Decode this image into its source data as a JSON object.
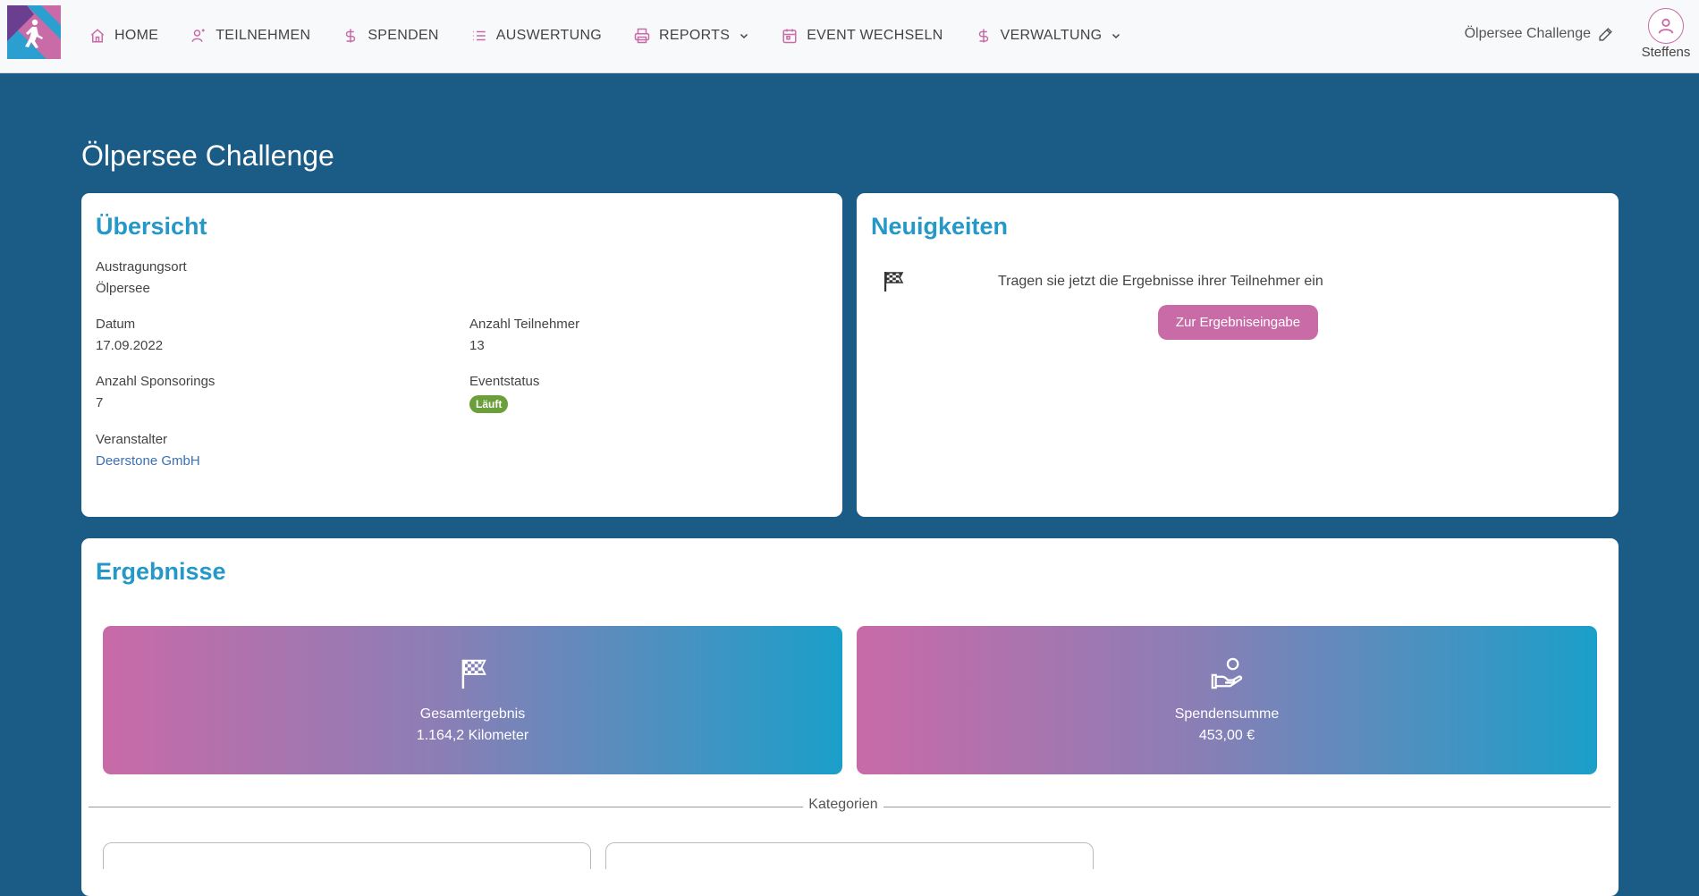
{
  "nav": {
    "items": [
      {
        "label": "HOME",
        "icon": "home-icon"
      },
      {
        "label": "TEILNEHMEN",
        "icon": "user-icon"
      },
      {
        "label": "SPENDEN",
        "icon": "dollar-icon"
      },
      {
        "label": "AUSWERTUNG",
        "icon": "list-icon"
      },
      {
        "label": "REPORTS",
        "icon": "printer-icon"
      },
      {
        "label": "EVENT WECHSELN",
        "icon": "calendar-icon"
      },
      {
        "label": "VERWALTUNG",
        "icon": "dollar-icon"
      }
    ],
    "event_name": "Ölpersee Challenge",
    "user_name": "Steffens"
  },
  "page": {
    "title": "Ölpersee Challenge"
  },
  "overview": {
    "title": "Übersicht",
    "location_label": "Austragungsort",
    "location_value": "Ölpersee",
    "date_label": "Datum",
    "date_value": "17.09.2022",
    "participants_label": "Anzahl Teilnehmer",
    "participants_value": "13",
    "sponsorings_label": "Anzahl Sponsorings",
    "sponsorings_value": "7",
    "status_label": "Eventstatus",
    "status_value": "Läuft",
    "organizer_label": "Veranstalter",
    "organizer_value": "Deerstone GmbH"
  },
  "news": {
    "title": "Neuigkeiten",
    "message": "Tragen sie jetzt die Ergebnisse ihrer Teilnehmer ein",
    "button_label": "Zur Ergebniseingabe"
  },
  "results": {
    "title": "Ergebnisse",
    "total_label": "Gesamtergebnis",
    "total_value": "1.164,2 Kilometer",
    "donation_label": "Spendensumme",
    "donation_value": "453,00 €",
    "categories_label": "Kategorien"
  },
  "colors": {
    "primary_blue": "#2598c8",
    "accent_pink": "#c86ba7",
    "page_background": "#1b5c87",
    "status_green": "#6b9f3a",
    "link_blue": "#3d6fb5"
  }
}
